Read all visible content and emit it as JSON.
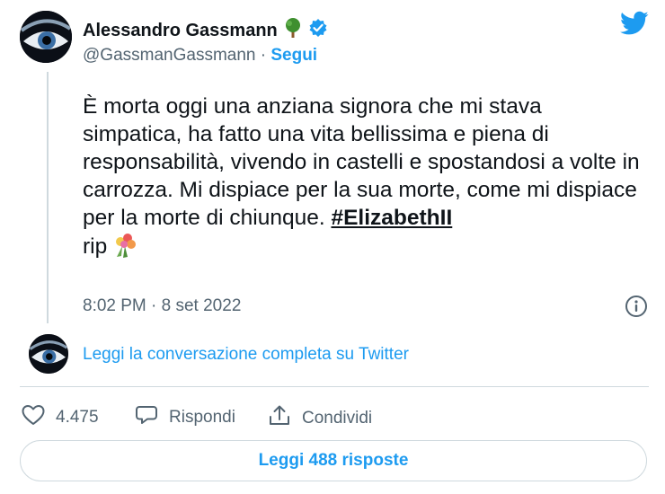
{
  "author": {
    "name": "Alessandro Gassmann",
    "handle": "@GassmanGassmann",
    "separator": " · ",
    "follow_label": "Segui",
    "verified": true
  },
  "tweet": {
    "text": "È morta oggi una anziana signora che mi stava simpatica, ha fatto una vita bellissima e piena di responsabilità, vivendo in castelli e spostandosi a volte in carrozza. Mi dispiace per la sua morte, come mi dispiace per la morte di chiunque. ",
    "hashtag": "#ElizabethII",
    "tail": " rip",
    "timestamp": "8:02 PM · 8 set 2022"
  },
  "conversation_link": "Leggi la conversazione completa su Twitter",
  "actions": {
    "likes": "4.475",
    "reply_label": "Rispondi",
    "share_label": "Condividi"
  },
  "replies_button": "Leggi 488 risposte",
  "colors": {
    "accent": "#1d9bf0",
    "text": "#0f1419",
    "secondary": "#536471",
    "border": "#cfd9de"
  },
  "icons": [
    "tree-emoji-icon",
    "verified-badge-icon",
    "twitter-bird-icon",
    "info-icon",
    "bouquet-emoji-icon",
    "heart-icon",
    "reply-icon",
    "share-icon"
  ]
}
